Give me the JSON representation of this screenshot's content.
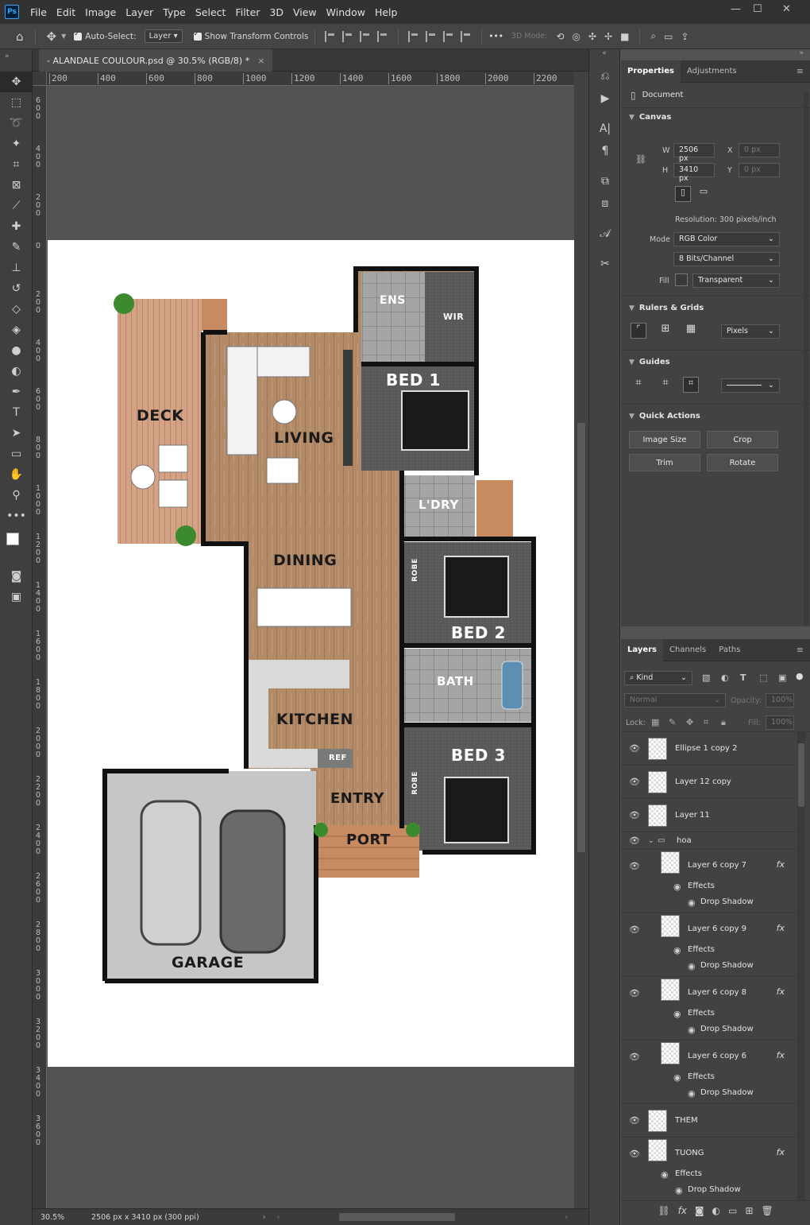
{
  "app": {
    "logo": "Ps",
    "menu": [
      "File",
      "Edit",
      "Image",
      "Layer",
      "Type",
      "Select",
      "Filter",
      "3D",
      "View",
      "Window",
      "Help"
    ],
    "window_controls": {
      "minimize": "—",
      "maximize": "☐",
      "close": "✕"
    }
  },
  "options": {
    "auto_select_label": "Auto-Select:",
    "auto_select_value": "Layer",
    "transform_label": "Show Transform Controls",
    "more": "•••",
    "mode_3d": "3D Mode:"
  },
  "document": {
    "tab_title": "- ALANDALE COULOUR.psd @ 30.5% (RGB/8) *",
    "tab_close": "×",
    "ruler_h": [
      "200",
      "400",
      "600",
      "800",
      "1000",
      "1200",
      "1400",
      "1600",
      "1800",
      "2000",
      "2200"
    ],
    "ruler_v": [
      "6\n0\n0",
      "4\n0\n0",
      "2\n0\n0",
      "0",
      "2\n0\n0",
      "4\n0\n0",
      "6\n0\n0",
      "8\n0\n0",
      "1\n0\n0\n0",
      "1\n2\n0\n0",
      "1\n4\n0\n0",
      "1\n6\n0\n0",
      "1\n8\n0\n0",
      "2\n0\n0\n0",
      "2\n2\n0\n0",
      "2\n4\n0\n0",
      "2\n6\n0\n0",
      "2\n8\n0\n0",
      "3\n0\n0\n0",
      "3\n2\n0\n0",
      "3\n4\n0\n0",
      "3\n6\n0\n0"
    ],
    "zoom": "30.5%",
    "status": "2506 px x 3410 px (300 ppi)"
  },
  "floorplan": {
    "rooms": {
      "deck": "DECK",
      "living": "LIVING",
      "dining": "DINING",
      "kitchen": "KITCHEN",
      "ref": "REF",
      "entry": "ENTRY",
      "port": "PORT",
      "garage": "GARAGE",
      "ens": "ENS",
      "wir": "WIR",
      "bed1": "BED 1",
      "ldry": "L'DRY",
      "robe1": "ROBE",
      "bed2": "BED 2",
      "bath": "BATH",
      "robe2": "ROBE",
      "bed3": "BED 3"
    },
    "colors": {
      "wall": "#111111",
      "wood": "#b38a68",
      "deck": "#d4a386",
      "carpet": "#595959",
      "tile": "#9e9e9e",
      "garage": "#c6c6c6"
    }
  },
  "properties": {
    "tabs": [
      "Properties",
      "Adjustments"
    ],
    "type": "Document",
    "canvas_head": "Canvas",
    "w_label": "W",
    "w_value": "2506 px",
    "h_label": "H",
    "h_value": "3410 px",
    "x_label": "X",
    "x_value": "0 px",
    "y_label": "Y",
    "y_value": "0 px",
    "resolution": "Resolution: 300 pixels/inch",
    "mode_label": "Mode",
    "mode_value": "RGB Color",
    "bits_value": "8 Bits/Channel",
    "fill_label": "Fill",
    "fill_value": "Transparent",
    "rulers_head": "Rulers & Grids",
    "units_value": "Pixels",
    "guides_head": "Guides",
    "quick_head": "Quick Actions",
    "buttons": [
      "Image Size",
      "Crop",
      "Trim",
      "Rotate"
    ]
  },
  "layers": {
    "tabs": [
      "Layers",
      "Channels",
      "Paths"
    ],
    "filter": "Kind",
    "blend": "Normal",
    "opacity_label": "Opacity:",
    "opacity_value": "100%",
    "lock_label": "Lock:",
    "fill_label": "Fill:",
    "fill_value": "100%",
    "items": [
      {
        "name": "Ellipse 1 copy 2"
      },
      {
        "name": "Layer 12 copy"
      },
      {
        "name": "Layer 11"
      },
      {
        "name": "hoa",
        "group": true
      },
      {
        "name": "Layer 6 copy 7",
        "fx": true
      },
      {
        "name": "Layer 6 copy 9",
        "fx": true
      },
      {
        "name": "Layer 6 copy 8",
        "fx": true
      },
      {
        "name": "Layer 6 copy 6",
        "fx": true
      },
      {
        "name": "THEM"
      },
      {
        "name": "TUONG",
        "fx": true
      }
    ],
    "effects_label": "Effects",
    "shadow_label": "Drop Shadow",
    "fx_label": "fx"
  }
}
